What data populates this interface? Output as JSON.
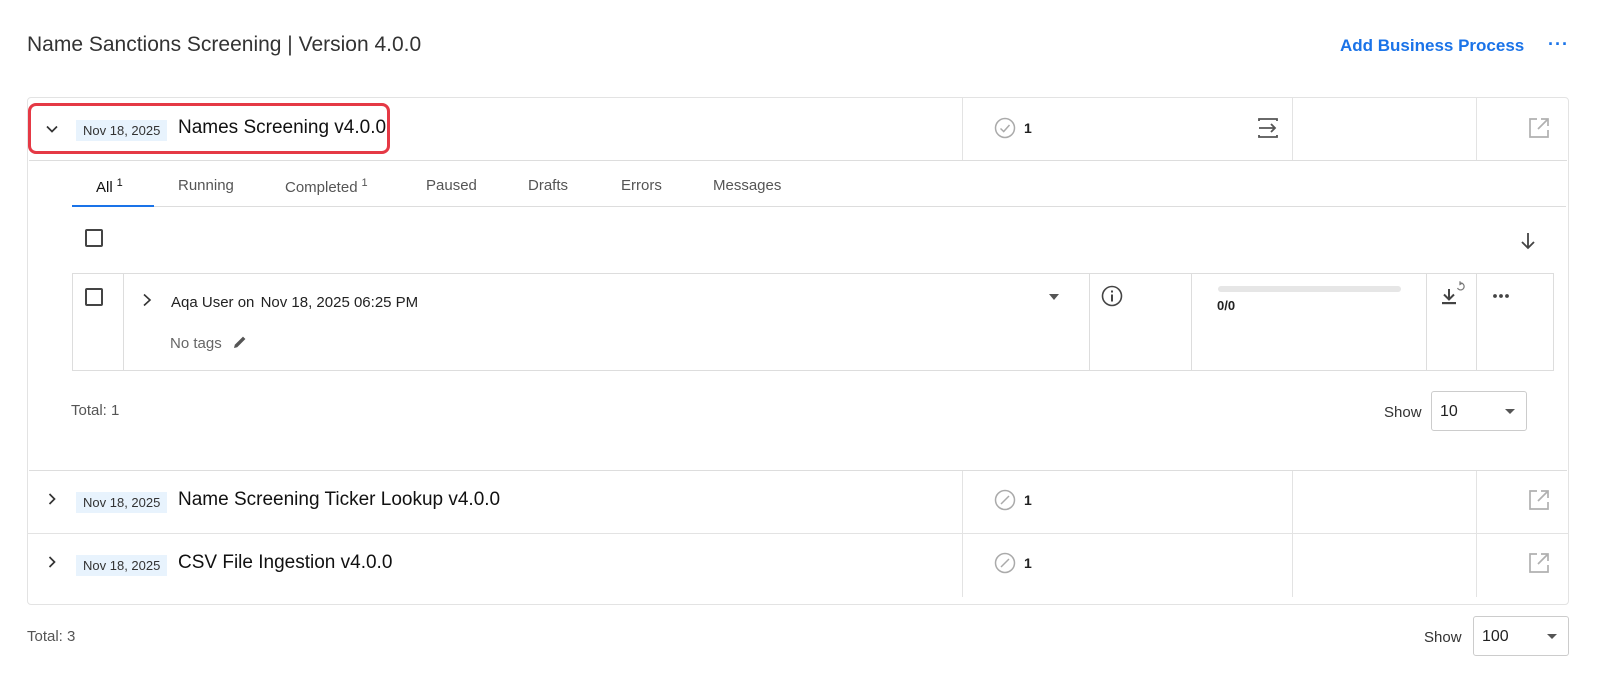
{
  "header": {
    "title": "Name Sanctions Screening | Version 4.0.0",
    "add_label": "Add Business Process",
    "more_label": "···"
  },
  "processes": [
    {
      "date": "Nov 18, 2025",
      "name": "Names Screening v4.0.0",
      "count": "1",
      "expanded": true,
      "status": "completed"
    },
    {
      "date": "Nov 18, 2025",
      "name": "Name Screening Ticker Lookup v4.0.0",
      "count": "1",
      "expanded": false,
      "status": "none"
    },
    {
      "date": "Nov 18, 2025",
      "name": "CSV File Ingestion v4.0.0",
      "count": "1",
      "expanded": false,
      "status": "none"
    }
  ],
  "tabs": [
    {
      "label": "All",
      "count": "1",
      "active": true
    },
    {
      "label": "Running",
      "count": ""
    },
    {
      "label": "Completed",
      "count": "1"
    },
    {
      "label": "Paused",
      "count": ""
    },
    {
      "label": "Drafts",
      "count": ""
    },
    {
      "label": "Errors",
      "count": ""
    },
    {
      "label": "Messages",
      "count": ""
    }
  ],
  "run": {
    "user": "Aqa User on",
    "datetime": "Nov 18, 2025 06:25 PM",
    "tags": "No tags",
    "progress_text": "0/0",
    "progress_fraction": 0
  },
  "inner_footer": {
    "total": "Total: 1",
    "show_label": "Show",
    "show_value": "10"
  },
  "footer": {
    "total": "Total: 3",
    "show_label": "Show",
    "show_value": "100"
  },
  "colors": {
    "accent": "#1a73e8",
    "highlight": "#e53945",
    "date_badge_bg": "#e8f3fd"
  },
  "icons": [
    "chevron-down-icon",
    "chevron-right-icon",
    "check-circle-icon",
    "no-entry-circle-icon",
    "merge-icon",
    "open-external-icon",
    "arrow-down-icon",
    "caret-down-icon",
    "info-icon",
    "download-sync-icon",
    "more-icon",
    "pencil-icon"
  ]
}
